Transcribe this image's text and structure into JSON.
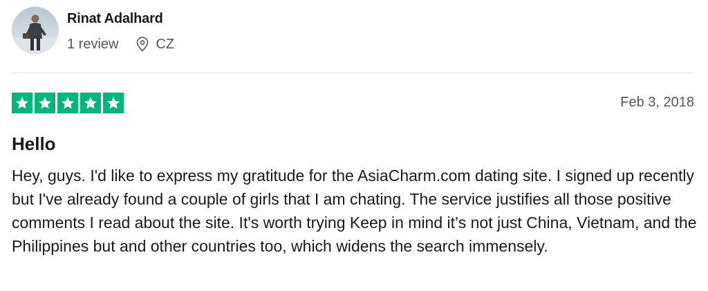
{
  "reviewer": {
    "name": "Rinat Adalhard",
    "review_count": "1 review",
    "country": "CZ",
    "avatar_icon": "user-photo"
  },
  "review": {
    "rating": 5,
    "rating_max": 5,
    "star_color": "#00b67a",
    "date": "Feb 3, 2018",
    "title": "Hello",
    "text": "Hey, guys. I'd like to express my gratitude for the AsiaCharm.com dating site. I signed up recently but I've already found a couple of girls that I am chating. The service justifies all those positive comments I read about the site. It's worth trying Keep in mind it’s not just China, Vietnam, and the Philippines but and other countries too, which widens the search immensely."
  }
}
